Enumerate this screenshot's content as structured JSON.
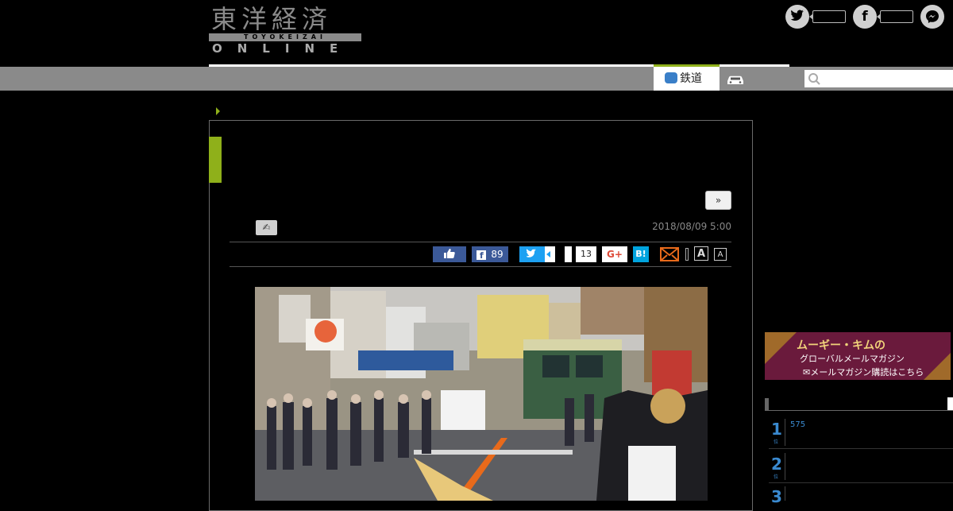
{
  "logo": {
    "kanji": "東洋経済",
    "roman": "TOYOKEIZAI",
    "online": "ONLINE"
  },
  "header_social": {
    "twitter_glyph": "🐦",
    "facebook_glyph": "f",
    "messenger_glyph": "〰"
  },
  "nav": {
    "tab_rail_label": "鉄道",
    "search_placeholder": ""
  },
  "article": {
    "more_label": "»",
    "date": "2018/08/09 5:00",
    "share": {
      "facebook_count": "89",
      "pocket_count": "13",
      "gplus_label": "G+",
      "hatena_label": "B!",
      "font_large": "A",
      "font_small": "A"
    }
  },
  "sidebar": {
    "banner_line1": "ムーギー・キムの",
    "banner_line2": "グローバルメールマガジン",
    "banner_line3": "メールマガジン購読はこちら",
    "ranking": [
      {
        "rank": "1",
        "count": "575"
      },
      {
        "rank": "2",
        "count": ""
      },
      {
        "rank": "3",
        "count": ""
      }
    ],
    "rank_suffix": "位"
  },
  "colors": {
    "accent_green": "#8fb01a",
    "nav_gray": "#8a8a8a",
    "rank_blue": "#3a8ad0",
    "facebook_blue": "#3b5998",
    "twitter_blue": "#1da1f2",
    "hatena_blue": "#00a4de"
  }
}
